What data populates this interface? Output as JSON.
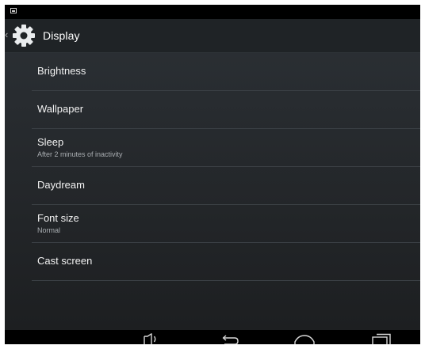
{
  "action_bar": {
    "title": "Display"
  },
  "settings": [
    {
      "title": "Brightness",
      "summary": ""
    },
    {
      "title": "Wallpaper",
      "summary": ""
    },
    {
      "title": "Sleep",
      "summary": "After 2 minutes of inactivity"
    },
    {
      "title": "Daydream",
      "summary": ""
    },
    {
      "title": "Font size",
      "summary": "Normal"
    },
    {
      "title": "Cast screen",
      "summary": ""
    }
  ],
  "nav_bar": {
    "buttons": [
      "volume-icon",
      "back-icon",
      "home-icon",
      "recents-icon"
    ]
  },
  "colors": {
    "background": "#232629",
    "action_bar": "#1f2326",
    "divider": "#3b4045",
    "text_primary": "#f2f2f2",
    "text_secondary": "#a9adb1",
    "system_bars": "#000000"
  }
}
